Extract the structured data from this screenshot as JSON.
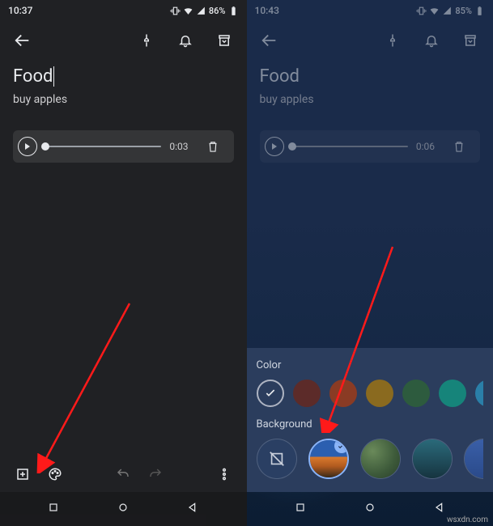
{
  "left": {
    "status": {
      "time": "10:37",
      "battery": "86%"
    },
    "note": {
      "title": "Food",
      "body": "buy apples"
    },
    "audio": {
      "duration": "0:03"
    }
  },
  "right": {
    "status": {
      "time": "10:43",
      "battery": "85%"
    },
    "note": {
      "title": "Food",
      "body": "buy apples"
    },
    "audio": {
      "duration": "0:06"
    },
    "picker": {
      "color_label": "Color",
      "background_label": "Background",
      "colors": [
        "#5c2b29",
        "#614a19",
        "#635d19",
        "#2d555e",
        "#16504b",
        "#1e3a5f",
        "#42275e"
      ],
      "backgrounds": [
        "none",
        "landscape-orange",
        "leaves-green",
        "dunes-teal",
        "mountain-blue"
      ],
      "selected_background_index": 1
    }
  },
  "watermark": "wsxdn.com"
}
